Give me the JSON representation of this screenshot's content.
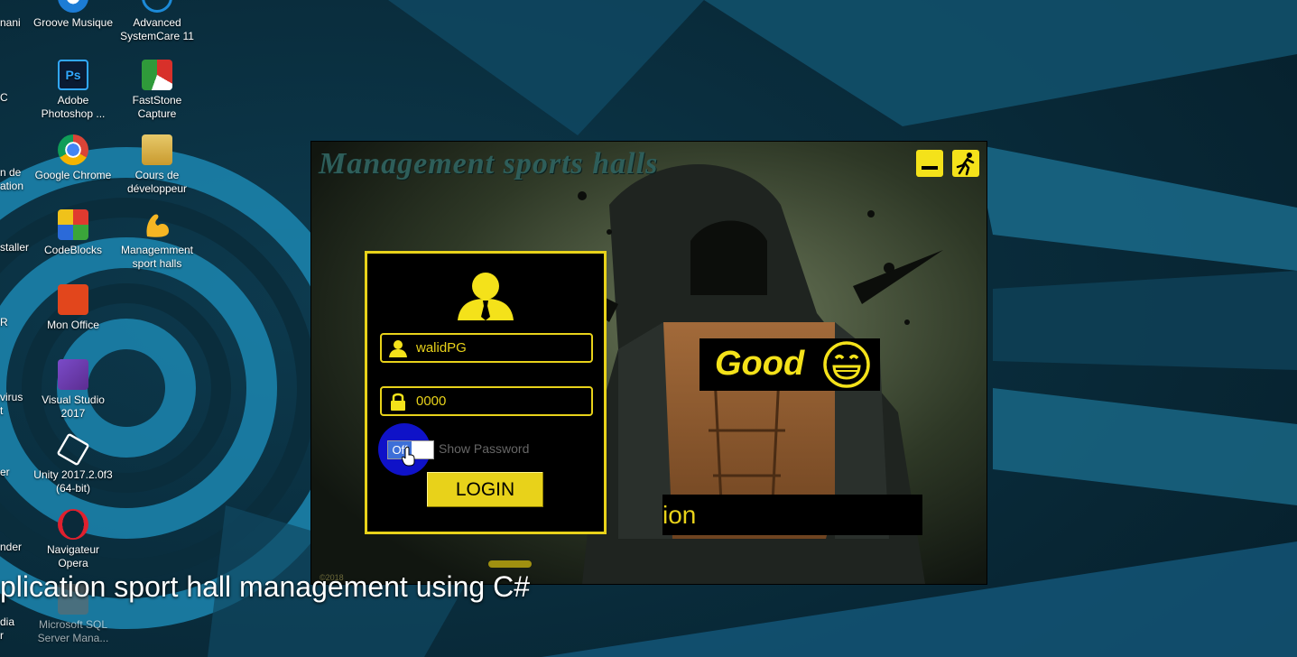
{
  "desktop": {
    "edge_labels": [
      "nani",
      "C",
      "n de",
      "ation",
      "staller",
      "R",
      "virus",
      "t",
      "er",
      "nder",
      "dia",
      "r"
    ],
    "icons": [
      {
        "label": "Groove Musique",
        "icon": "groove-music-icon"
      },
      {
        "label": "Advanced SystemCare 11",
        "icon": "advanced-systemcare-icon"
      },
      {
        "label": "Adobe Photoshop ...",
        "icon": "photoshop-icon"
      },
      {
        "label": "FastStone Capture",
        "icon": "faststone-capture-icon"
      },
      {
        "label": "Google Chrome",
        "icon": "chrome-icon"
      },
      {
        "label": "Cours de développeur",
        "icon": "folder-icon"
      },
      {
        "label": "CodeBlocks",
        "icon": "codeblocks-icon"
      },
      {
        "label": "Managemment sport halls",
        "icon": "muscle-arm-icon"
      },
      {
        "label": "Mon Office",
        "icon": "office-icon"
      },
      {
        "label": "Visual Studio 2017",
        "icon": "visual-studio-icon"
      },
      {
        "label": "Unity 2017.2.0f3 (64-bit)",
        "icon": "unity-icon"
      },
      {
        "label": "Navigateur Opera",
        "icon": "opera-icon"
      },
      {
        "label": "Microsoft SQL Server Mana...",
        "icon": "sql-server-icon"
      }
    ]
  },
  "app": {
    "title": "Management sports halls",
    "username": "walidPG",
    "password": "0000",
    "toggle_label": "Off",
    "show_password_label": "Show Password",
    "login_label": "LOGIN",
    "good_label": "Good",
    "ion_text": "ion",
    "copyright": "©2018",
    "colors": {
      "accent": "#e8d21a",
      "toggle_blue": "#0f12c8",
      "title_teal": "#2e5e5a"
    }
  },
  "caption": "plication sport hall management using C#"
}
